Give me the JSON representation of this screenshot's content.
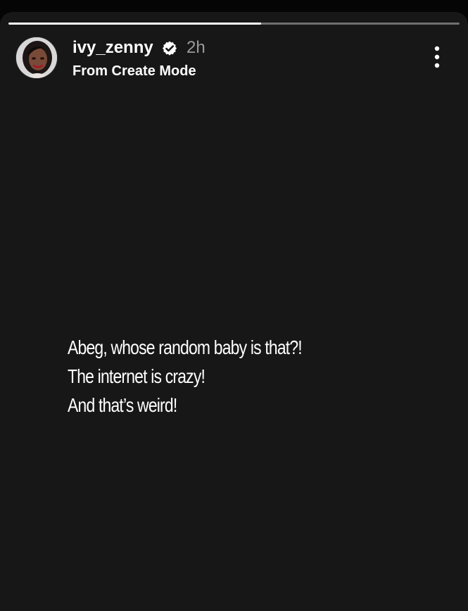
{
  "progress": {
    "fraction": 0.56
  },
  "header": {
    "username": "ivy_zenny",
    "time_ago": "2h",
    "subtitle": "From Create Mode",
    "avatar_icon": "avatar-profile-photo",
    "verified_icon": "verified-badge-icon",
    "menu_icon": "more-vertical-icon"
  },
  "story": {
    "lines": [
      "Abeg, whose random baby is that?!",
      "The internet is crazy!",
      "And that’s weird!"
    ]
  },
  "colors": {
    "page_background": "#050505",
    "story_background": "#171717",
    "text": "#ffffff",
    "muted_text": "#9b9b9b",
    "progress_track": "#707070",
    "progress_fill": "#ffffff"
  }
}
